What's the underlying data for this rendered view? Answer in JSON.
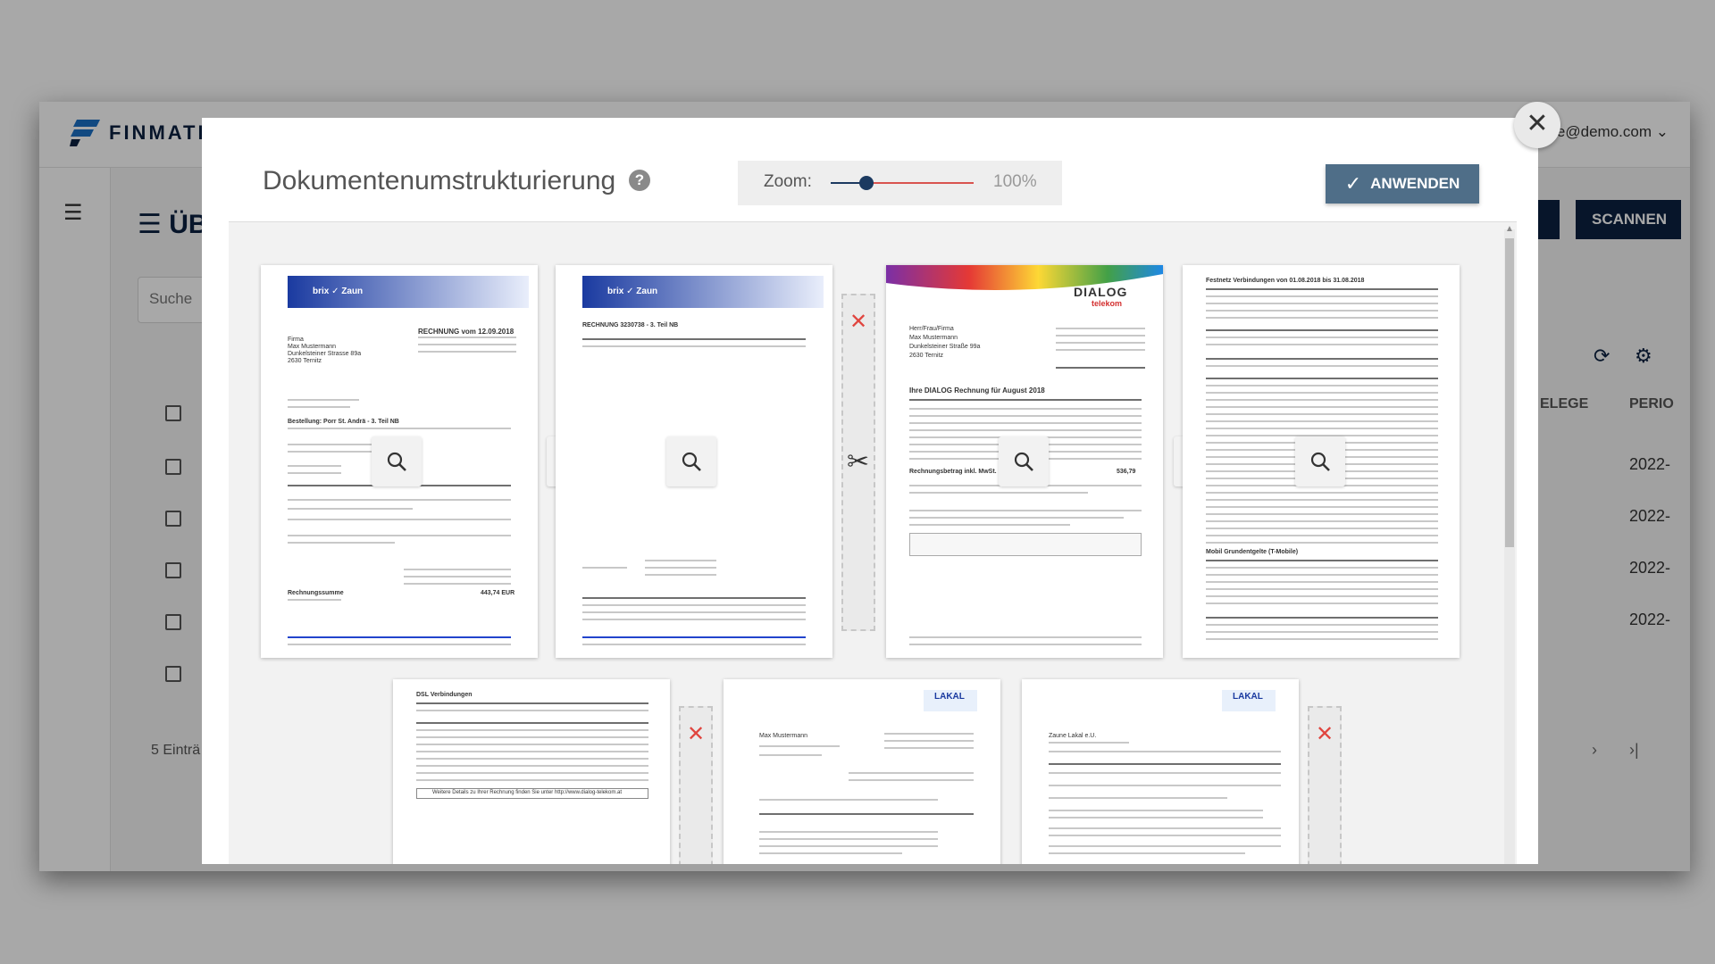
{
  "app": {
    "logo_text": "FINMATIC",
    "user_email": "ete@demo.com",
    "page_title": "ÜB",
    "search_placeholder": "Suche",
    "scan_button": "SCANNEN",
    "column_belege": "ELEGE",
    "column_periode": "PERIO",
    "row_values": [
      "2022-",
      "2022-",
      "2022-",
      "2022-"
    ],
    "footer_count": "5 Einträ"
  },
  "modal": {
    "title": "Dokumentenumstrukturierung",
    "zoom_label": "Zoom:",
    "zoom_value": "100%",
    "zoom_fraction": 0.25,
    "apply_button": "ANWENDEN"
  },
  "pages": {
    "page1": {
      "logo": "brix ✓ Zaun",
      "heading": "RECHNUNG vom 12.09.2018",
      "address": [
        "Firma",
        "Max Mustermann",
        "Dunkelsteiner Strasse 89a",
        "2630 Ternitz"
      ],
      "bestellung": "Bestellung: Porr St. Andrä - 3. Teil NB",
      "totals_label": "Rechnungssumme",
      "totals_value": "443,74 EUR"
    },
    "page2": {
      "logo": "brix ✓ Zaun",
      "heading": "RECHNUNG 3230738 - 3. Teil NB"
    },
    "page3": {
      "brand": "DIALOG",
      "brand_sub": "telekom",
      "address": [
        "Herr/Frau/Firma",
        "Max Mustermann",
        "Dunkelsteiner Straße 99a",
        "2630 Ternitz"
      ],
      "heading": "Ihre DIALOG Rechnung für August 2018",
      "total_label": "Rechnungsbetrag inkl. MwSt.",
      "total_value": "536,79"
    },
    "page4": {
      "heading": "Festnetz Verbindungen von 01.08.2018 bis 31.08.2018",
      "section": "Mobil Grundentgelte (T-Mobile)"
    },
    "page5": {
      "heading": "DSL Verbindungen",
      "footer": "Weitere Details zu Ihrer Rechnung finden Sie unter http://www.dialog-telekom.at"
    },
    "page6": {
      "brand": "LAKAL",
      "customer": "Max Mustermann"
    },
    "page7": {
      "brand": "LAKAL",
      "customer": "Zaune Lakal e.U."
    }
  },
  "icons": {
    "close": "close-icon",
    "help": "help-icon",
    "zoom": "magnifier-icon",
    "cut": "scissors-icon",
    "join": "join-left-icon",
    "remove": "remove-x-icon"
  },
  "colors": {
    "apply_button": "#4f6e88",
    "zoom_track": "#d9534f",
    "remove_x": "#e0453f",
    "brand_navy": "#0b2140"
  }
}
